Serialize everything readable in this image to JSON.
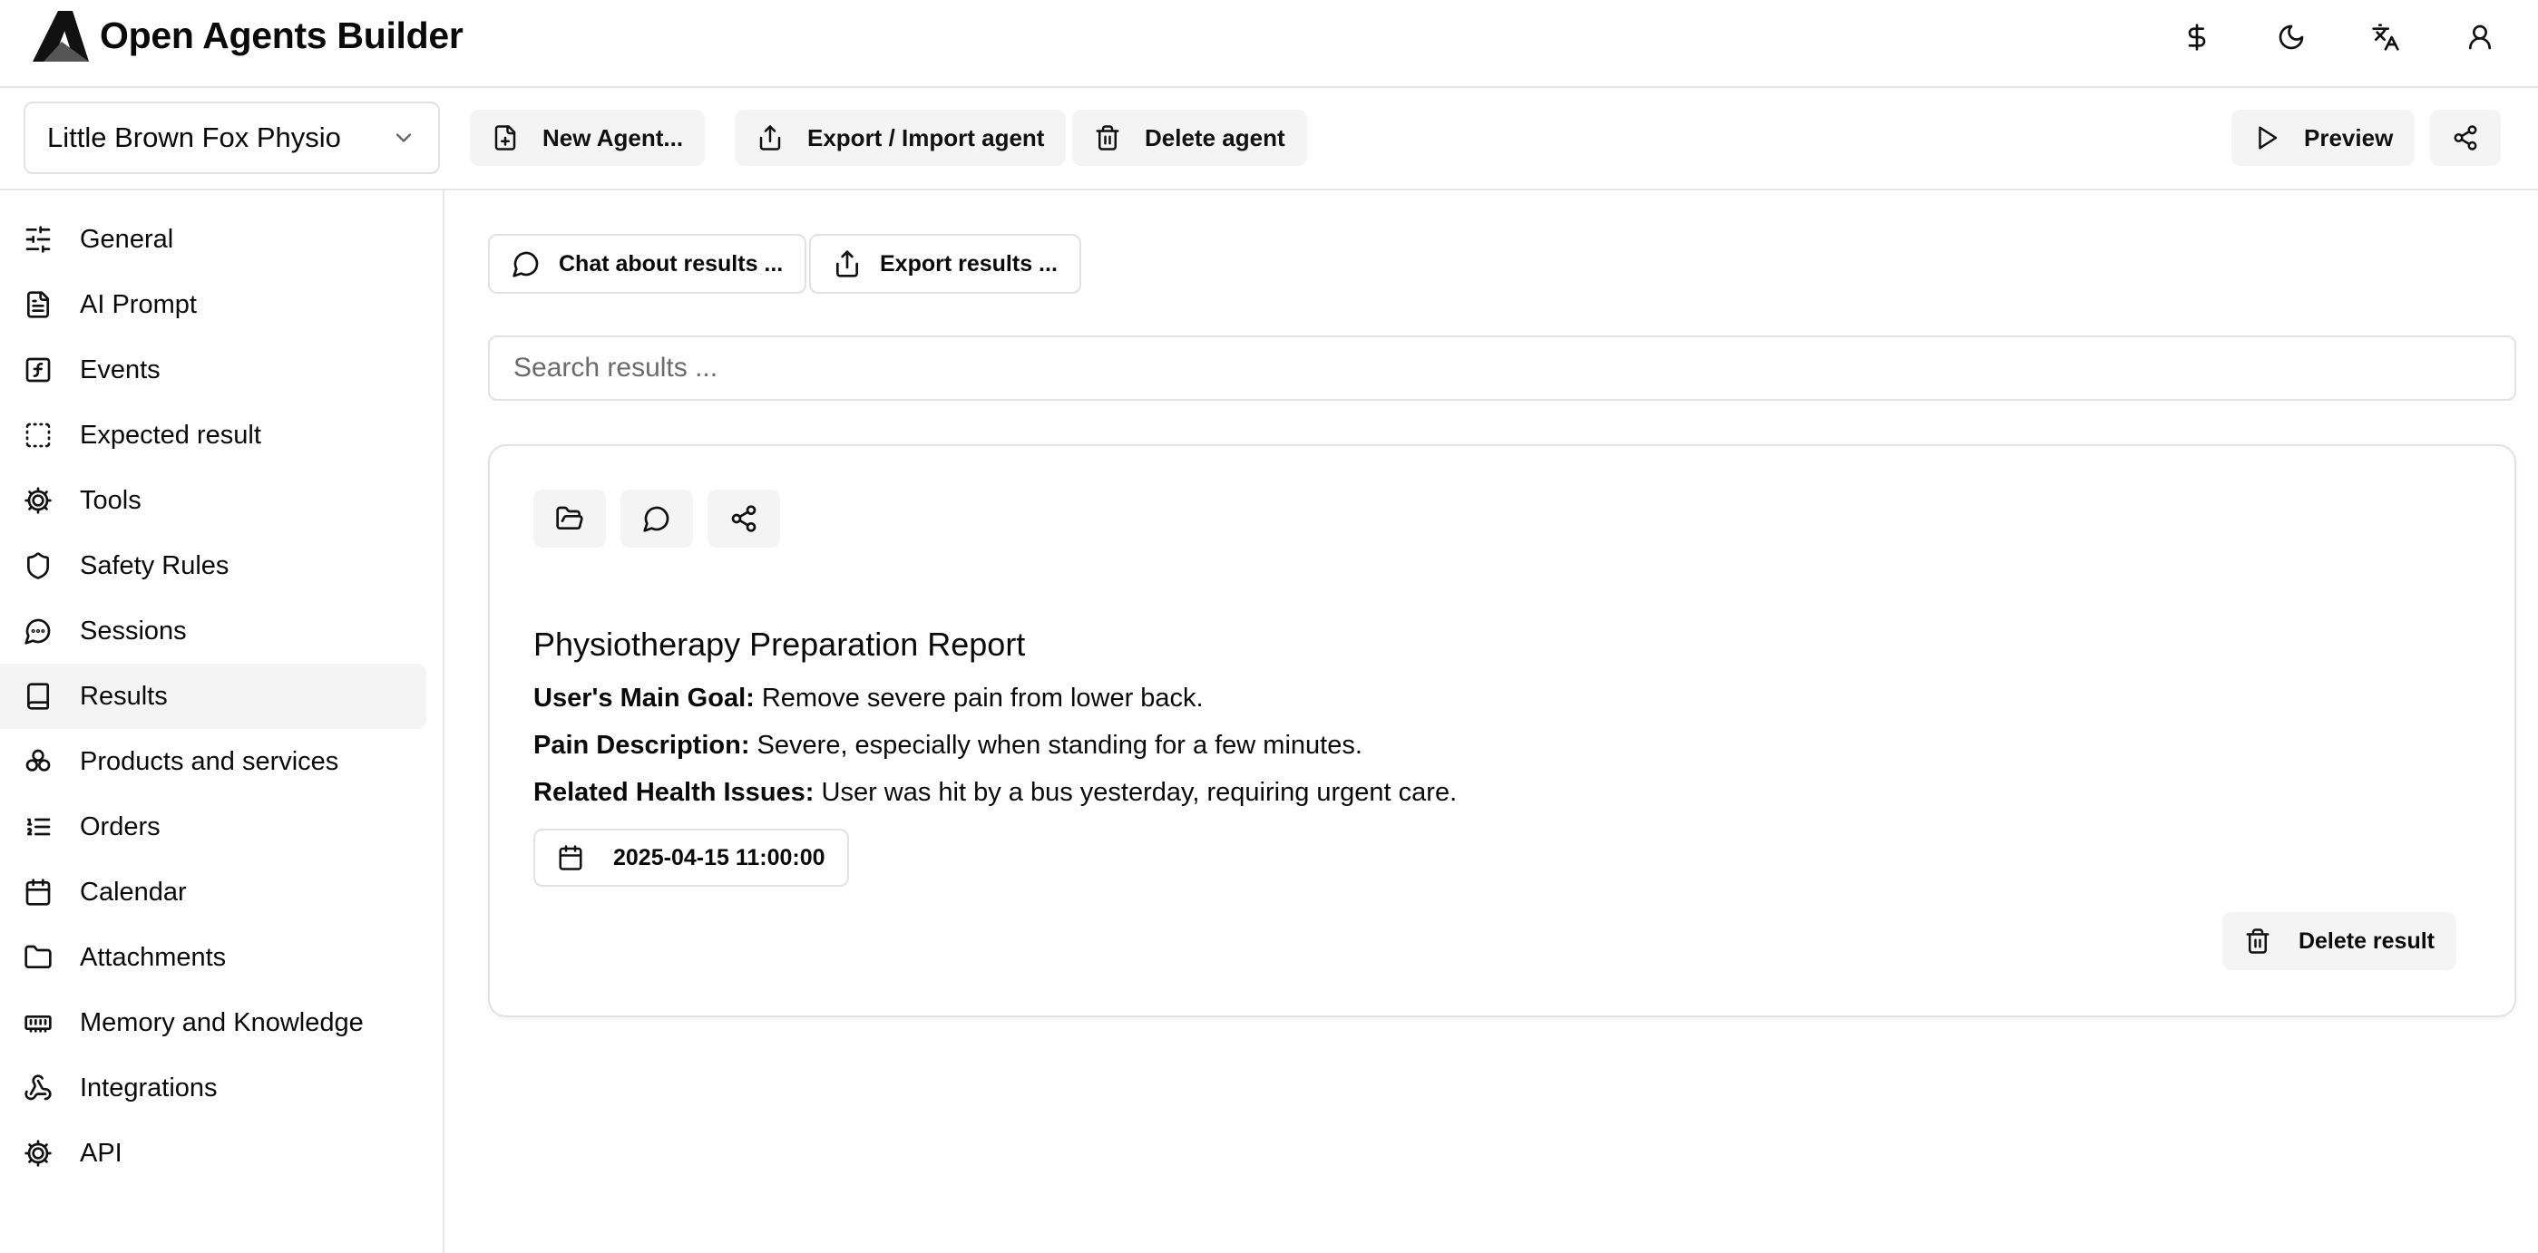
{
  "app": {
    "title": "Open Agents Builder"
  },
  "header_icons": [
    "dollar-icon",
    "moon-icon",
    "translate-icon",
    "user-icon"
  ],
  "toolbar": {
    "agent_selected": "Little Brown Fox Physio",
    "new_agent": "New Agent...",
    "export_import": "Export / Import agent",
    "delete_agent": "Delete agent",
    "preview": "Preview"
  },
  "sidebar": {
    "items": [
      {
        "label": "General",
        "icon": "sliders-icon"
      },
      {
        "label": "AI Prompt",
        "icon": "file-text-icon"
      },
      {
        "label": "Events",
        "icon": "function-icon"
      },
      {
        "label": "Expected result",
        "icon": "dashed-square-icon"
      },
      {
        "label": "Tools",
        "icon": "cog-icon"
      },
      {
        "label": "Safety Rules",
        "icon": "shield-icon"
      },
      {
        "label": "Sessions",
        "icon": "message-circle-icon"
      },
      {
        "label": "Results",
        "icon": "book-icon",
        "active": true
      },
      {
        "label": "Products and services",
        "icon": "boxes-icon"
      },
      {
        "label": "Orders",
        "icon": "list-ordered-icon"
      },
      {
        "label": "Calendar",
        "icon": "calendar-icon"
      },
      {
        "label": "Attachments",
        "icon": "folder-icon"
      },
      {
        "label": "Memory and Knowledge",
        "icon": "memory-icon"
      },
      {
        "label": "Integrations",
        "icon": "webhook-icon"
      },
      {
        "label": "API",
        "icon": "cog-icon"
      }
    ]
  },
  "main": {
    "chat_button": "Chat about results ...",
    "export_button": "Export results ...",
    "search_placeholder": "Search results ...",
    "result": {
      "title": "Physiotherapy Preparation Report",
      "fields": [
        {
          "label": "User's Main Goal:",
          "value": " Remove severe pain from lower back."
        },
        {
          "label": "Pain Description:",
          "value": " Severe, especially when standing for a few minutes."
        },
        {
          "label": "Related Health Issues:",
          "value": " User was hit by a bus yesterday, requiring urgent care."
        }
      ],
      "date": "2025-04-15 11:00:00",
      "delete_label": "Delete result"
    }
  }
}
